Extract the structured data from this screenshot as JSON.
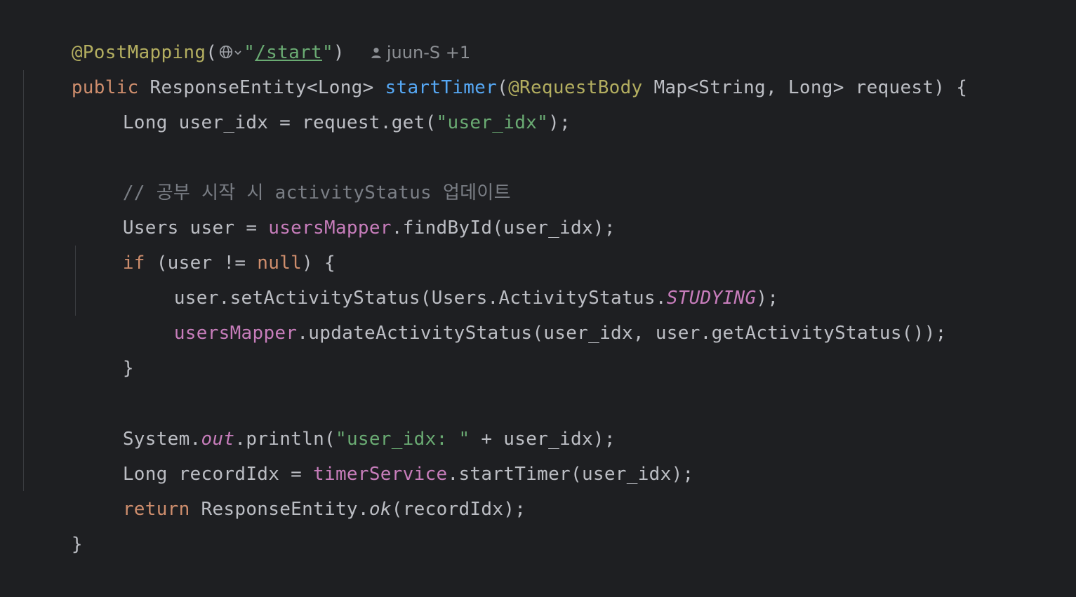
{
  "code": {
    "l1": {
      "annotation": "@PostMapping",
      "open": "(",
      "quote_open": "\"",
      "path": "/start",
      "quote_close": "\"",
      "close": ")",
      "author": "juun-S",
      "authors_extra": "+1"
    },
    "l2": {
      "kw": "public",
      "type": " ResponseEntity<Long> ",
      "method": "startTimer",
      "open": "(",
      "annotation": "@RequestBody",
      "rest": " Map<String, Long> request) {"
    },
    "l3": {
      "prefix": "Long user_idx = request.get(",
      "str": "\"user_idx\"",
      "suffix": ");"
    },
    "l5": {
      "comment": "// 공부 시작 시 activityStatus 업데이트"
    },
    "l6": {
      "prefix": "Users user = ",
      "field": "usersMapper",
      "suffix": ".findById(user_idx);"
    },
    "l7": {
      "kw_if": "if",
      "mid": " (user != ",
      "kw_null": "null",
      "suffix": ") {"
    },
    "l8": {
      "prefix": "user.setActivityStatus(Users.ActivityStatus.",
      "const": "STUDYING",
      "suffix": ");"
    },
    "l9": {
      "field": "usersMapper",
      "suffix": ".updateActivityStatus(user_idx, user.getActivityStatus());"
    },
    "l10": {
      "text": "}"
    },
    "l12": {
      "prefix": "System.",
      "static": "out",
      "mid": ".println(",
      "str": "\"user_idx: \"",
      "suffix": " + user_idx);"
    },
    "l13": {
      "prefix": "Long recordIdx = ",
      "field": "timerService",
      "suffix": ".startTimer(user_idx);"
    },
    "l14": {
      "kw": "return",
      "mid": " ResponseEntity.",
      "method": "ok",
      "suffix": "(recordIdx);"
    },
    "l15": {
      "text": "}"
    }
  },
  "colors": {
    "background": "#1e1f22",
    "default_text": "#bcbec4",
    "keyword": "#cf8e6d",
    "annotation": "#b3ae60",
    "string": "#6aab73",
    "method_declaration": "#56a8f5",
    "field": "#c77dbb",
    "comment": "#7a7e85"
  },
  "icons": {
    "url_inlay": "globe-icon",
    "author_inlay": "person-icon"
  }
}
